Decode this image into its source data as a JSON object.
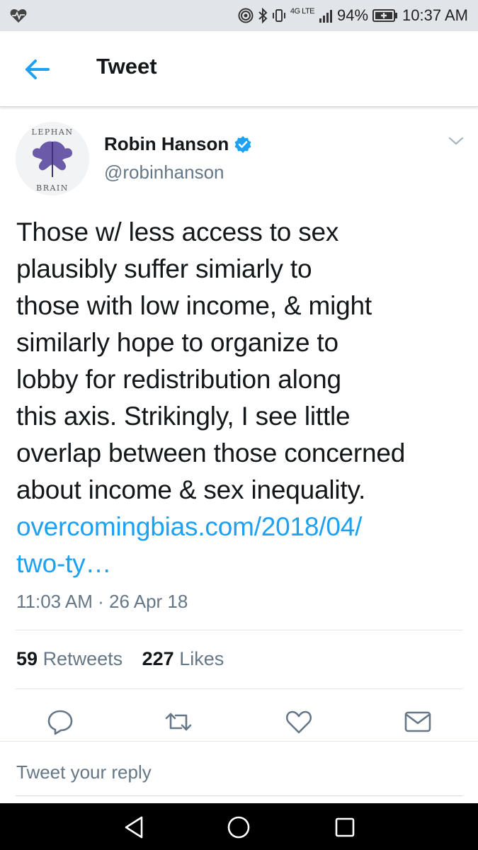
{
  "status_bar": {
    "network_label": "4G LTE",
    "battery": "94%",
    "time": "10:37 AM",
    "icons": [
      "heart-rate-icon",
      "hotspot-icon",
      "bluetooth-icon",
      "vibrate-icon",
      "signal-icon",
      "battery-icon"
    ]
  },
  "app_bar": {
    "title": "Tweet",
    "back_icon": "arrow-left-icon"
  },
  "tweet": {
    "avatar_text_top": "LEPHAN",
    "avatar_text_bottom": "BRAIN",
    "author_name": "Robin Hanson",
    "verified": true,
    "handle": "@robinhanson",
    "text_lines": [
      "Those w/ less access to sex",
      "plausibly suffer simiarly to",
      "those with low income, & might",
      "similarly hope to organize to",
      "lobby for redistribution along",
      "this axis. Strikingly, I see little",
      "overlap between those concerned",
      "about income & sex inequality."
    ],
    "link_lines": [
      "overcomingbias.com/2018/04/",
      "two-ty…"
    ],
    "timestamp": "11:03 AM · 26 Apr 18",
    "retweets_count": "59",
    "retweets_label": "Retweets",
    "likes_count": "227",
    "likes_label": "Likes"
  },
  "actions": [
    "reply-icon",
    "retweet-icon",
    "like-icon",
    "message-icon"
  ],
  "reply": {
    "placeholder": "Tweet your reply"
  },
  "colors": {
    "accent": "#1da1f2",
    "text": "#14171a",
    "secondary": "#657786",
    "status_bar_bg": "#e1e4e8"
  }
}
